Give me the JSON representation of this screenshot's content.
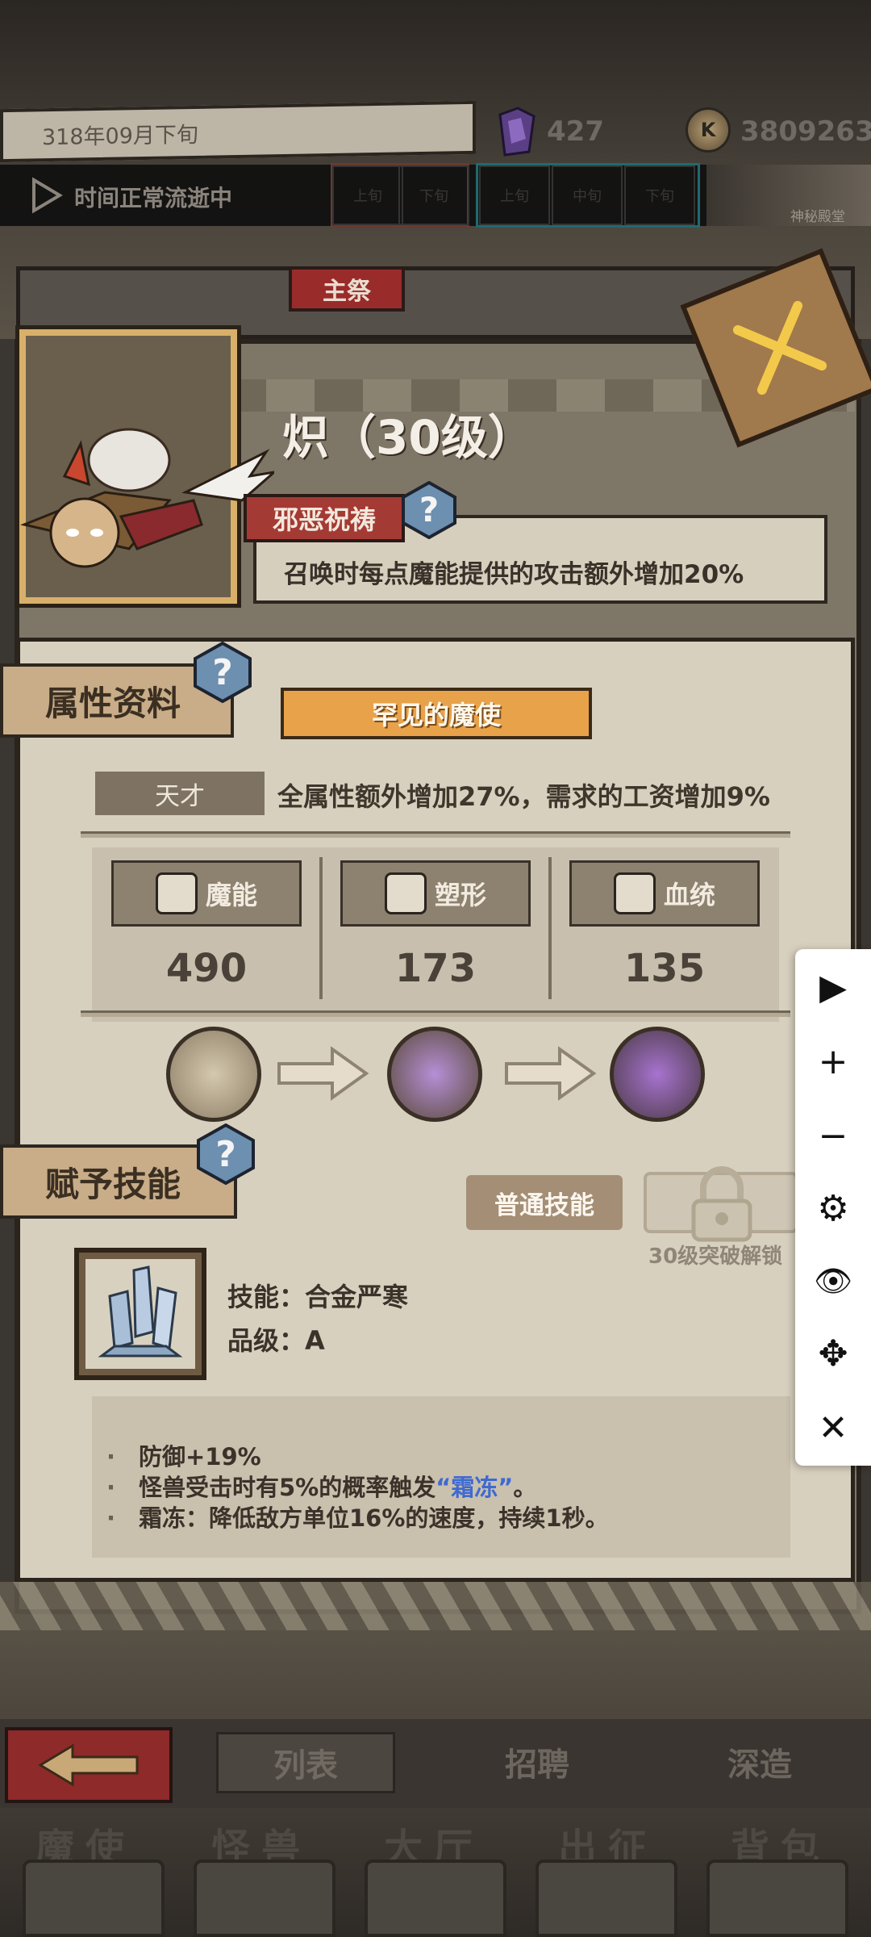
{
  "hud": {
    "date": "318年09月下旬",
    "crystals": "427",
    "coins": "3809263",
    "coin_icon_glyph": "K",
    "time_status": "时间正常流逝中",
    "periods_left": [
      "上旬",
      "下旬"
    ],
    "periods_right": [
      "上旬",
      "中旬",
      "下旬"
    ],
    "location": "神秘殿堂"
  },
  "panel": {
    "role_tag": "主祭",
    "name": "炽（30级）",
    "trait": {
      "title": "邪恶祝祷",
      "help": "?",
      "description": "召唤时每点魔能提供的攻击额外增加20%"
    }
  },
  "attributes": {
    "tab": "属性资料",
    "help": "?",
    "rarity": "罕见的魔使",
    "talent_label": "天才",
    "talent_desc": "全属性额外增加27%，需求的工资增加9%",
    "stats": [
      {
        "name": "魔能",
        "value": "490",
        "icon": "magic-claw-icon"
      },
      {
        "name": "塑形",
        "value": "173",
        "icon": "body-shape-icon"
      },
      {
        "name": "血统",
        "value": "135",
        "icon": "bloodline-icon"
      }
    ],
    "evolution": [
      "hooded-figure-icon",
      "purple-sigil-icon",
      "purple-eye-icon"
    ]
  },
  "skills": {
    "tab": "赋予技能",
    "help": "?",
    "normal_skill": "普通技能",
    "unlock_hint": "30级突破解锁",
    "skill_name": "技能：合金严寒",
    "skill_grade": "品级：A",
    "skill_icon": "ice-crystal-icon",
    "description": {
      "line1": "防御+19%",
      "line2_pre": "怪兽受击时有5%的概率触发",
      "line2_hl": "“霜冻”",
      "line2_post": "。",
      "line3": "霜冻：降低敌方单位16%的速度，持续1秒。"
    }
  },
  "toolbar": {
    "play": "▶",
    "zoom_in": "+",
    "zoom_out": "−",
    "settings": "⚙",
    "view": "👁",
    "move": "✥",
    "close": "✕"
  },
  "nav": {
    "sub_tabs": [
      "列表",
      "招聘",
      "深造"
    ],
    "main_tabs": [
      "魔使",
      "怪兽",
      "大厅",
      "出征",
      "背包"
    ]
  },
  "colors": {
    "accent_red": "#9a2b2b",
    "rarity_orange": "#e8a34a",
    "parchment": "#d8d0bf",
    "highlight_blue": "#3f6ad0"
  }
}
